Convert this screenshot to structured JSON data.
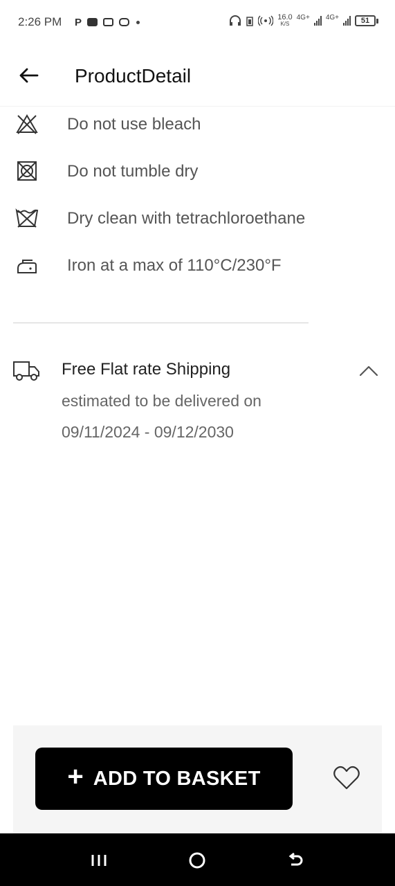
{
  "status_bar": {
    "time": "2:26 PM",
    "net_speed": "16.0",
    "net_unit": "K/S",
    "network_1": "4G+",
    "network_2": "4G+",
    "battery": "51",
    "icons": [
      "p-icon",
      "youtube-icon",
      "reader-icon",
      "instagram-icon",
      "dot-icon",
      "headphones-icon",
      "sim-icon",
      "hotspot-icon",
      "signal-icon",
      "signal-icon",
      "battery-icon"
    ]
  },
  "header": {
    "title": "ProductDetail",
    "back_icon": "arrow-left-icon"
  },
  "care": [
    {
      "icon": "no-bleach-icon",
      "label": "Do not use bleach"
    },
    {
      "icon": "no-tumble-dry-icon",
      "label": "Do not tumble dry"
    },
    {
      "icon": "dry-clean-icon",
      "label": "Dry clean with tetrachloroethane"
    },
    {
      "icon": "iron-icon",
      "label": "Iron at a max of 110°C/230°F"
    }
  ],
  "shipping": {
    "icon": "truck-icon",
    "title": "Free Flat rate Shipping",
    "subtitle": "estimated to be delivered on",
    "dates": "09/11/2024 - 09/12/2030",
    "toggle_icon": "chevron-up-icon"
  },
  "actions": {
    "add_to_basket": "ADD TO BASKET",
    "plus_glyph": "+",
    "favorite_icon": "heart-icon"
  },
  "nav": {
    "icons": [
      "menu-icon",
      "home-icon",
      "back-icon"
    ]
  },
  "colors": {
    "button_bg": "#000000",
    "button_text": "#ffffff",
    "action_area_bg": "#f5f5f5",
    "nav_bg": "#000000",
    "muted_text": "#555555"
  }
}
